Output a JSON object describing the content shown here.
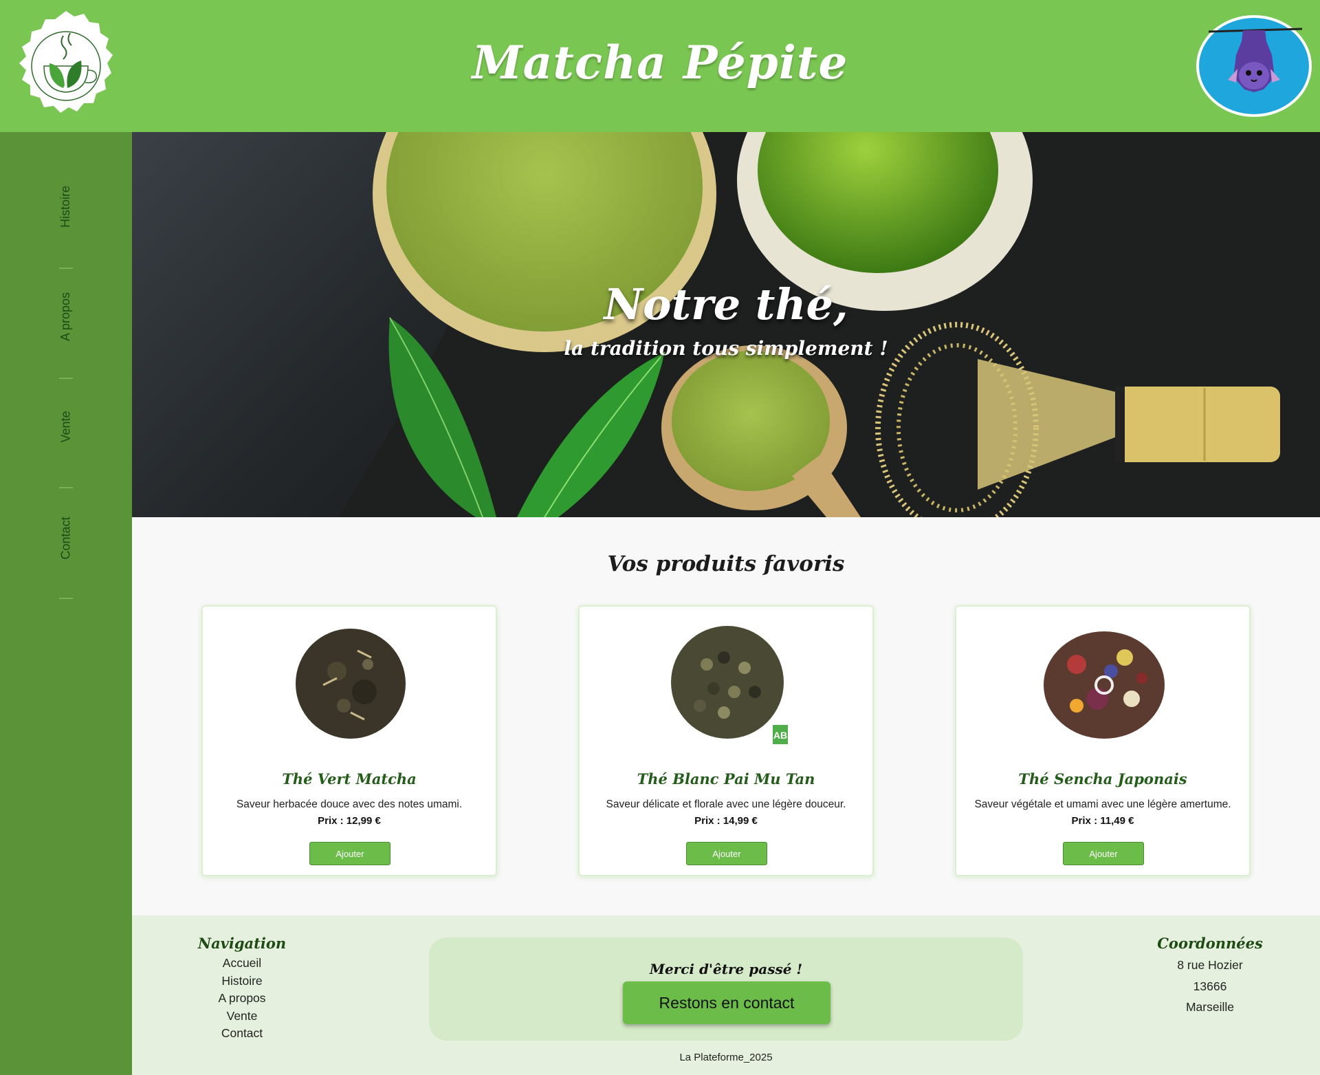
{
  "header": {
    "title": "Matcha Pépite",
    "logo_icon": "tea-cup-leaf-icon",
    "avatar_icon": "bat-avatar-icon"
  },
  "sidebar": {
    "items": [
      {
        "label": "Histoire"
      },
      {
        "label": "A propos"
      },
      {
        "label": "Vente"
      },
      {
        "label": "Contact"
      }
    ]
  },
  "hero": {
    "title": "Notre thé,",
    "subtitle": "la tradition tous simplement !"
  },
  "products": {
    "title": "Vos produits favoris",
    "items": [
      {
        "name": "Thé Vert Matcha",
        "description": "Saveur herbacée douce avec des notes umami.",
        "price": "Prix : 12,99 €",
        "button": "Ajouter"
      },
      {
        "name": "Thé Blanc Pai Mu Tan",
        "description": "Saveur délicate et florale avec une légère douceur.",
        "price": "Prix : 14,99 €",
        "button": "Ajouter"
      },
      {
        "name": "Thé Sencha Japonais",
        "description": "Saveur végétale et umami avec une légère amertume.",
        "price": "Prix : 11,49 €",
        "button": "Ajouter"
      }
    ]
  },
  "footer": {
    "nav_title": "Navigation",
    "nav_links": [
      "Accueil",
      "Histoire",
      "A propos",
      "Vente",
      "Contact"
    ],
    "thanks": "Merci d'être passé !",
    "cta": "Restons en contact",
    "contact_title": "Coordonnées",
    "address": [
      "8 rue Hozier",
      "13666",
      "Marseille"
    ],
    "copyright": "La Plateforme_2025"
  },
  "colors": {
    "header_green": "#7ac653",
    "sidebar_green": "#5a9338",
    "accent_green": "#6cbc4a",
    "footer_bg": "#e5f1de"
  }
}
